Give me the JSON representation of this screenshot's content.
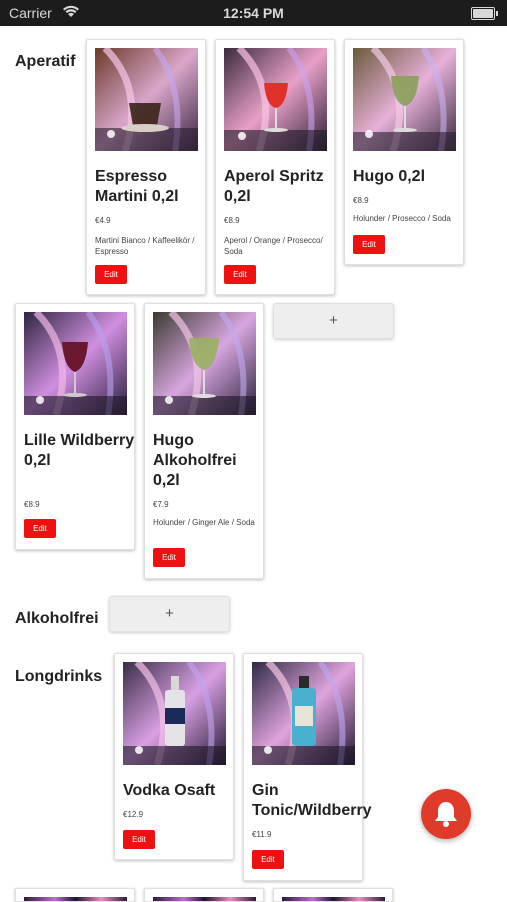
{
  "status_bar": {
    "carrier": "Carrier",
    "time": "12:54 PM"
  },
  "sections": {
    "aperatif": {
      "title": "Aperatif",
      "add_label": "+"
    },
    "alkoholfrei": {
      "title": "Alkoholfrei",
      "add_label": "+"
    },
    "longdrinks": {
      "title": "Longdrinks"
    }
  },
  "edit_label": "Edit",
  "products": [
    {
      "name": "Espresso Martini 0,2l",
      "price": "€4.9",
      "description": "Martini Bianco / Kaffeelikör / Espresso"
    },
    {
      "name": "Aperol Spritz 0,2l",
      "price": "€8.9",
      "description": "Aperol / Orange / Prosecco/ Soda"
    },
    {
      "name": "Hugo 0,2l",
      "price": "€8.9",
      "description": "Holunder / Prosecco / Soda"
    },
    {
      "name": "Lille Wildberry 0,2l",
      "price": "€8.9",
      "description": ""
    },
    {
      "name": "Hugo Alkoholfrei 0,2l",
      "price": "€7.9",
      "description": "Holunder / Ginger Ale / Soda"
    },
    {
      "name": "Vodka Osaft",
      "price": "€12.9",
      "description": ""
    },
    {
      "name": "Gin Tonic/Wildberry",
      "price": "€11.9",
      "description": ""
    }
  ],
  "colors": {
    "accent_red": "#ee1111",
    "bell_red": "#e03a2a"
  }
}
